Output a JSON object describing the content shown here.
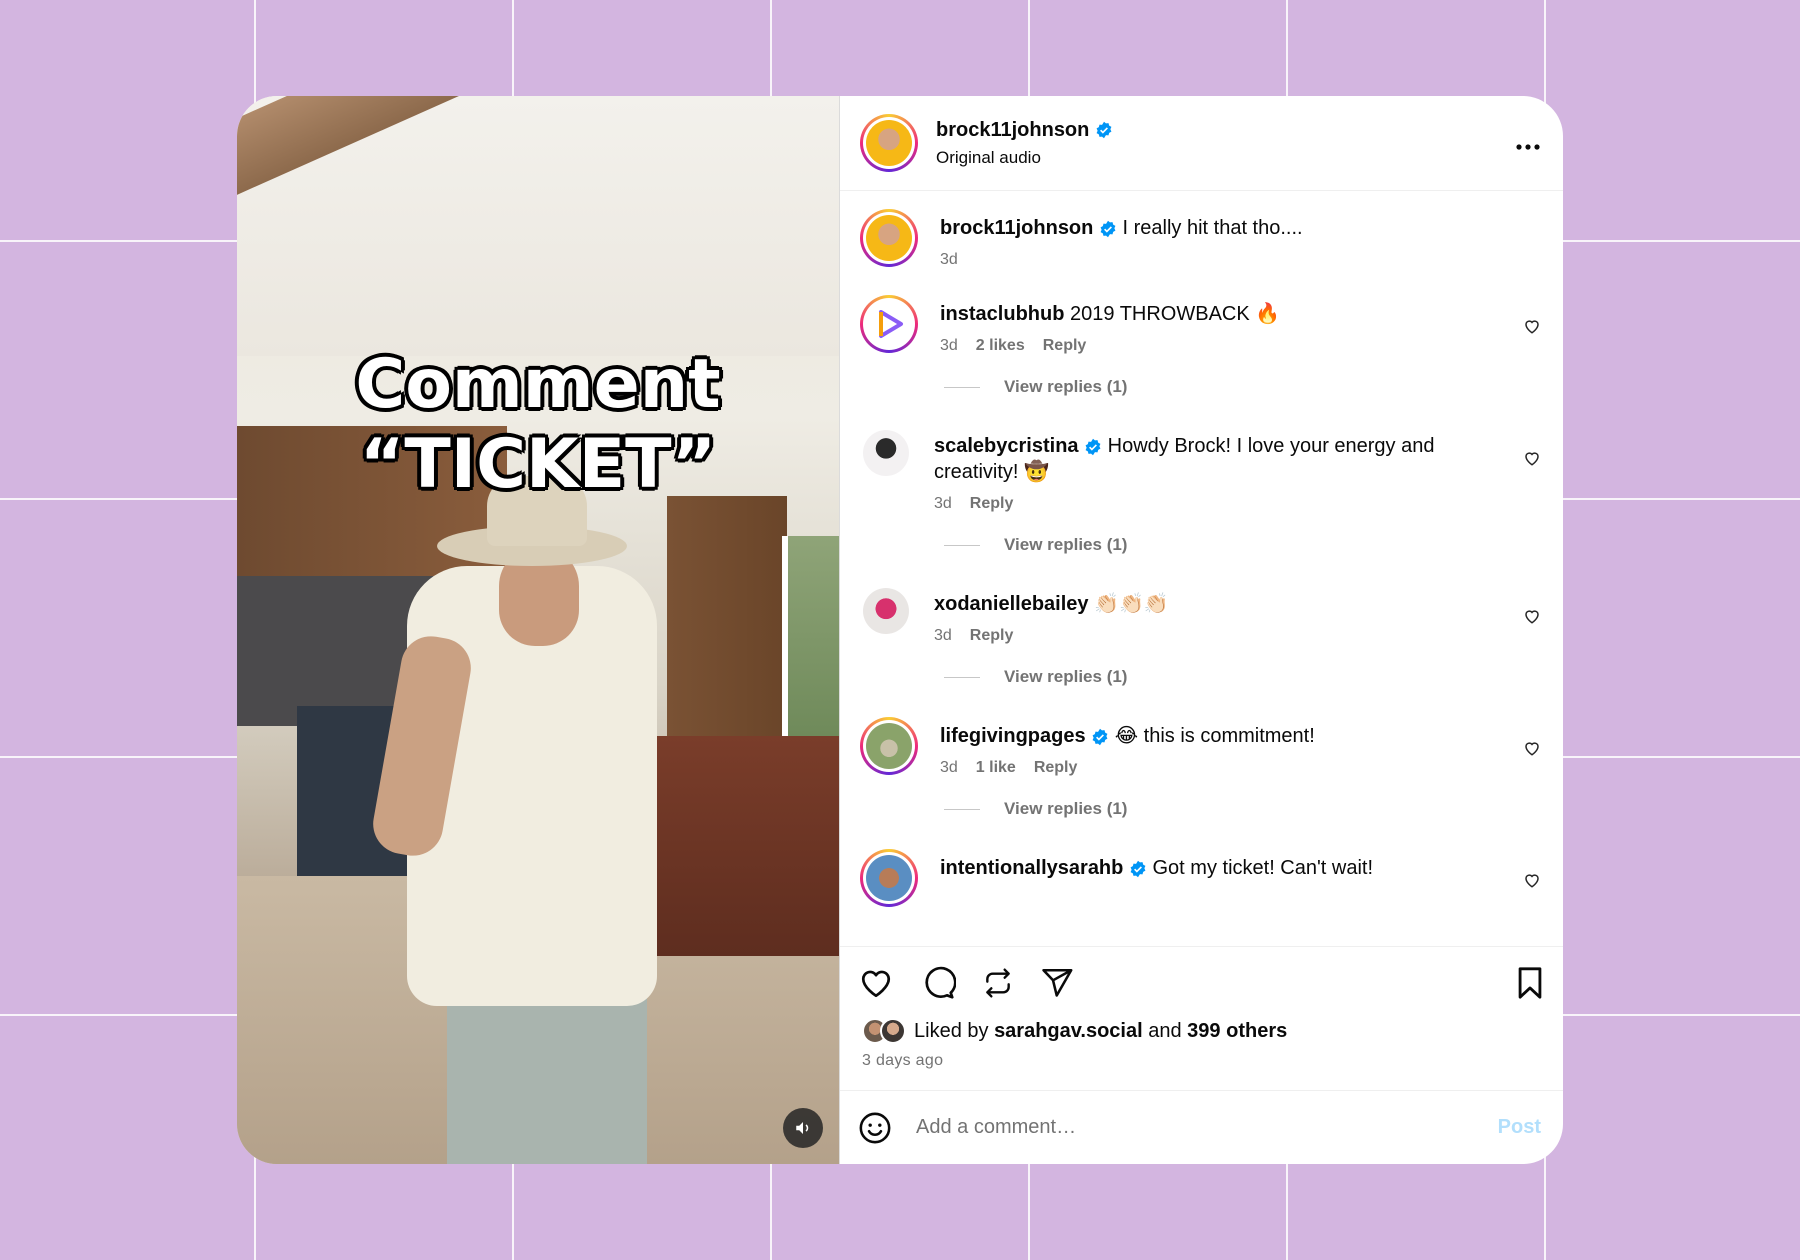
{
  "video": {
    "overlay_line1": "Comment",
    "overlay_line2": "“TICKET”",
    "sound_icon": "speaker-icon"
  },
  "header": {
    "username": "brock11johnson",
    "subtitle": "Original audio",
    "more_icon": "more-icon"
  },
  "caption": {
    "username": "brock11johnson",
    "text": "I really hit that tho....",
    "time": "3d"
  },
  "comments": [
    {
      "username": "instaclubhub",
      "text": "2019 THROWBACK 🔥",
      "time": "3d",
      "likes": "2 likes",
      "reply": "Reply",
      "view_replies": "View replies (1)",
      "verified": false
    },
    {
      "username": "scalebycristina",
      "text": "Howdy Brock! I love your energy and creativity! 🤠",
      "time": "3d",
      "likes": "",
      "reply": "Reply",
      "view_replies": "View replies (1)",
      "verified": true
    },
    {
      "username": "xodaniellebailey",
      "text": "👏🏻👏🏻👏🏻",
      "time": "3d",
      "likes": "",
      "reply": "Reply",
      "view_replies": "View replies (1)",
      "verified": false
    },
    {
      "username": "lifegivingpages",
      "text": "😂 this is commitment!",
      "time": "3d",
      "likes": "1 like",
      "reply": "Reply",
      "view_replies": "View replies (1)",
      "verified": true
    },
    {
      "username": "intentionallysarahb",
      "text": "Got my ticket! Can't wait!",
      "time": "",
      "likes": "",
      "reply": "",
      "view_replies": "",
      "verified": true
    }
  ],
  "likes": {
    "prefix": "Liked by",
    "user": "sarahgav.social",
    "and": "and",
    "others": "399 others"
  },
  "posted_time": "3 days ago",
  "add_comment": {
    "placeholder": "Add a comment…",
    "post_label": "Post"
  },
  "colors": {
    "background": "#d3b5e0",
    "verified": "#0095f6",
    "post_disabled": "#b2dffc"
  }
}
